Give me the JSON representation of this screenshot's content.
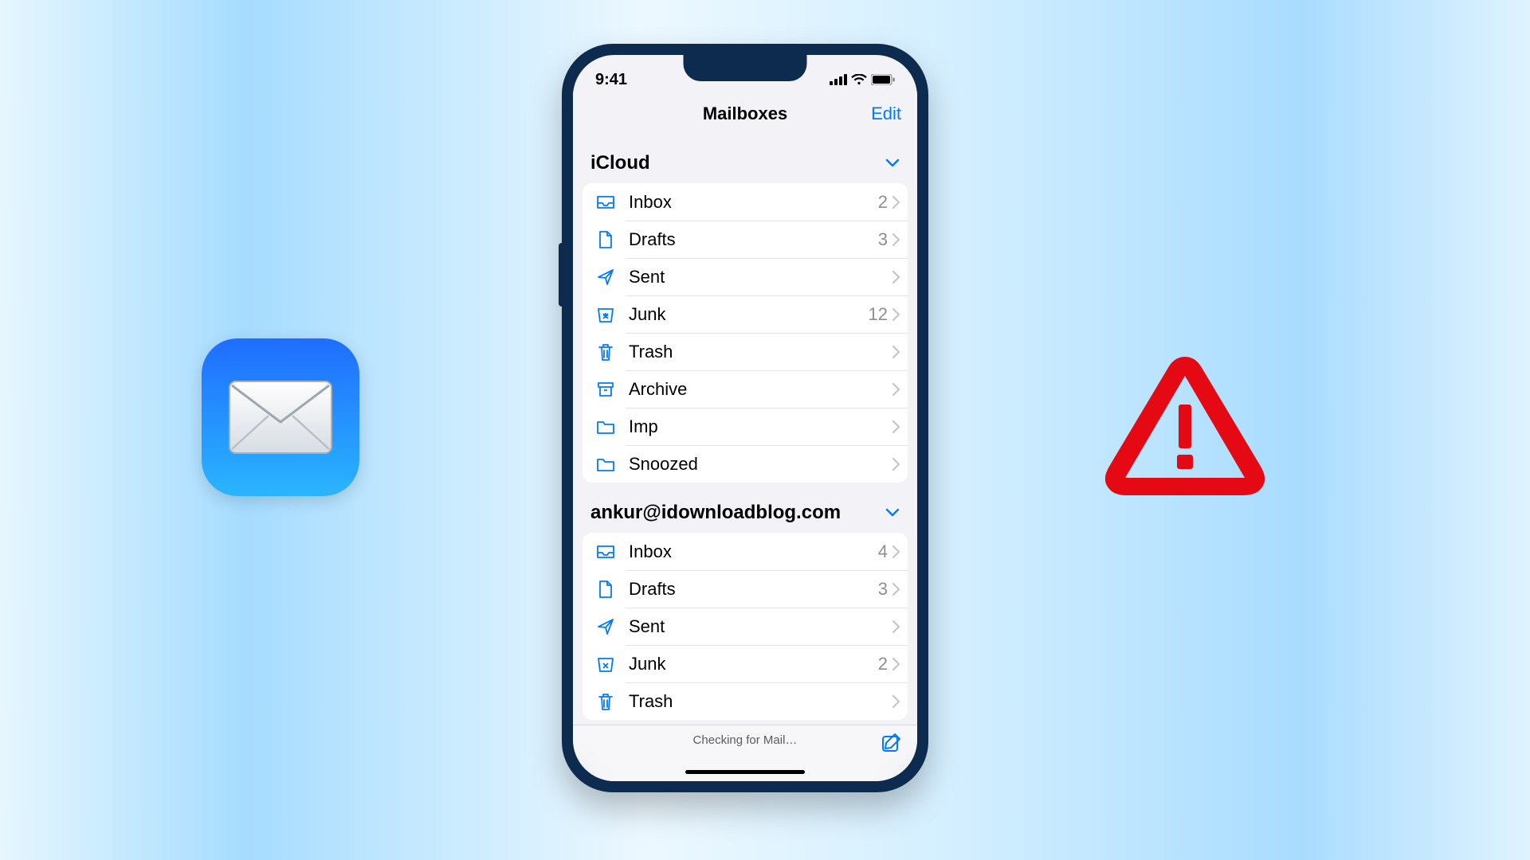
{
  "status": {
    "time": "9:41"
  },
  "nav": {
    "title": "Mailboxes",
    "edit": "Edit"
  },
  "sections": [
    {
      "title": "iCloud",
      "rows": [
        {
          "icon": "inbox",
          "label": "Inbox",
          "count": "2"
        },
        {
          "icon": "drafts",
          "label": "Drafts",
          "count": "3"
        },
        {
          "icon": "sent",
          "label": "Sent",
          "count": ""
        },
        {
          "icon": "junk",
          "label": "Junk",
          "count": "12"
        },
        {
          "icon": "trash",
          "label": "Trash",
          "count": ""
        },
        {
          "icon": "archive",
          "label": "Archive",
          "count": ""
        },
        {
          "icon": "folder",
          "label": "Imp",
          "count": ""
        },
        {
          "icon": "folder",
          "label": "Snoozed",
          "count": ""
        }
      ]
    },
    {
      "title": "ankur@idownloadblog.com",
      "rows": [
        {
          "icon": "inbox",
          "label": "Inbox",
          "count": "4"
        },
        {
          "icon": "drafts",
          "label": "Drafts",
          "count": "3"
        },
        {
          "icon": "sent",
          "label": "Sent",
          "count": ""
        },
        {
          "icon": "junk",
          "label": "Junk",
          "count": "2"
        },
        {
          "icon": "trash",
          "label": "Trash",
          "count": ""
        }
      ]
    }
  ],
  "bottom": {
    "status": "Checking for Mail…"
  }
}
